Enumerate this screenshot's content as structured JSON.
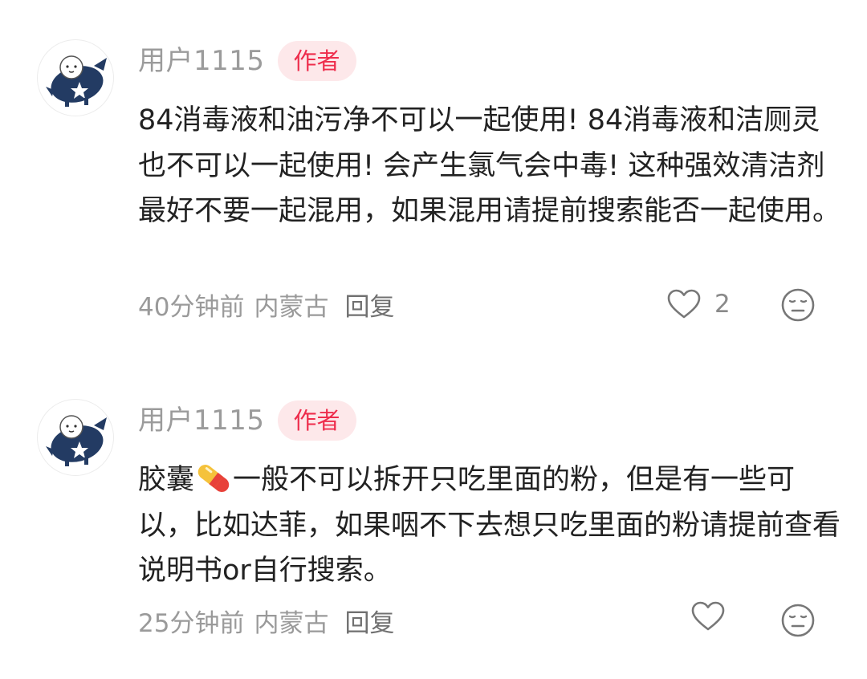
{
  "comments": [
    {
      "username": "用户1115",
      "badge": "作者",
      "content": "84消毒液和油污净不可以一起使用! 84消毒液和洁厕灵也不可以一起使用! 会产生氯气会中毒! 这种强效清洁剂最好不要一起混用，如果混用请提前搜索能否一起使用。",
      "time": "40分钟前",
      "location": "内蒙古",
      "reply_label": "回复",
      "like_count": "2",
      "like_icon": "heart-outline-icon",
      "dislike_icon": "neutral-face-icon"
    },
    {
      "username": "用户1115",
      "badge": "作者",
      "content_before_emoji": "胶囊",
      "emoji": "pill-emoji",
      "content_after_emoji": "一般不可以拆开只吃里面的粉，但是有一些可以，比如达菲，如果咽不下去想只吃里面的粉请提前查看说明书or自行搜索。",
      "time": "25分钟前",
      "location": "内蒙古",
      "reply_label": "回复",
      "like_icon": "heart-outline-icon",
      "dislike_icon": "neutral-face-icon"
    }
  ],
  "colors": {
    "badge_bg": "#fde8ea",
    "badge_text": "#ee2d4c",
    "meta_text": "#9a9a9a",
    "body_text": "#222222",
    "icon_gray": "#777777"
  }
}
